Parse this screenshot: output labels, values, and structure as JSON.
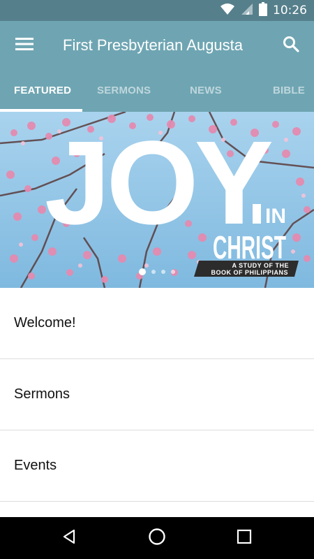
{
  "status_bar": {
    "time": "10:26",
    "icons": [
      "wifi-icon",
      "cell-signal-icon",
      "battery-icon"
    ]
  },
  "app_bar": {
    "title": "First Presbyterian Augusta",
    "menu_icon": "hamburger-menu-icon",
    "search_icon": "search-icon"
  },
  "tabs": [
    {
      "label": "FEATURED",
      "active": true
    },
    {
      "label": "SERMONS",
      "active": false
    },
    {
      "label": "NEWS",
      "active": false
    },
    {
      "label": "BIBLE",
      "active": false
    }
  ],
  "banner": {
    "headline": "JOY",
    "subtitle_in": "IN",
    "subtitle_christ": "CHRIST",
    "caption_line1": "A STUDY OF THE",
    "caption_line2": "BOOK OF PHILIPPIANS",
    "pages": 4,
    "active_page": 1
  },
  "list": [
    {
      "label": "Welcome!"
    },
    {
      "label": "Sermons"
    },
    {
      "label": "Events"
    }
  ],
  "nav_bar": {
    "buttons": [
      "back-icon",
      "home-icon",
      "recents-icon"
    ]
  },
  "colors": {
    "status_bar": "#557f8b",
    "app_bar": "#6fa5b2",
    "banner_sky": "#8ec3e4",
    "blossom": "#e48bb0"
  }
}
